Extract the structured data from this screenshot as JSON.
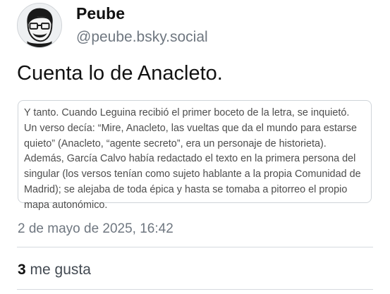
{
  "author": {
    "display_name": "Peube",
    "handle": "@peube.bsky.social",
    "avatar_icon": "cartoon-face-glasses-icon"
  },
  "post": {
    "text": "Cuenta lo de Anacleto.",
    "quoted_image_text": "Y tanto. Cuando Leguina recibió el primer boceto de la letra, se inquietó. Un verso decía: “Mire, Anacleto, las vueltas que da el mundo para estarse quieto” (Anacleto, “agente secreto”, era un personaje de historieta). Además, García Calvo había redactado el texto en la primera persona del singular (los versos tenían como sujeto hablante a la propia Comunidad de Madrid); se alejaba de toda épica y hasta se tomaba a pitorreo el propio mapa autonómico.",
    "timestamp": "2 de mayo de 2025, 16:42"
  },
  "stats": {
    "likes_count": "3",
    "likes_label": "me gusta"
  }
}
